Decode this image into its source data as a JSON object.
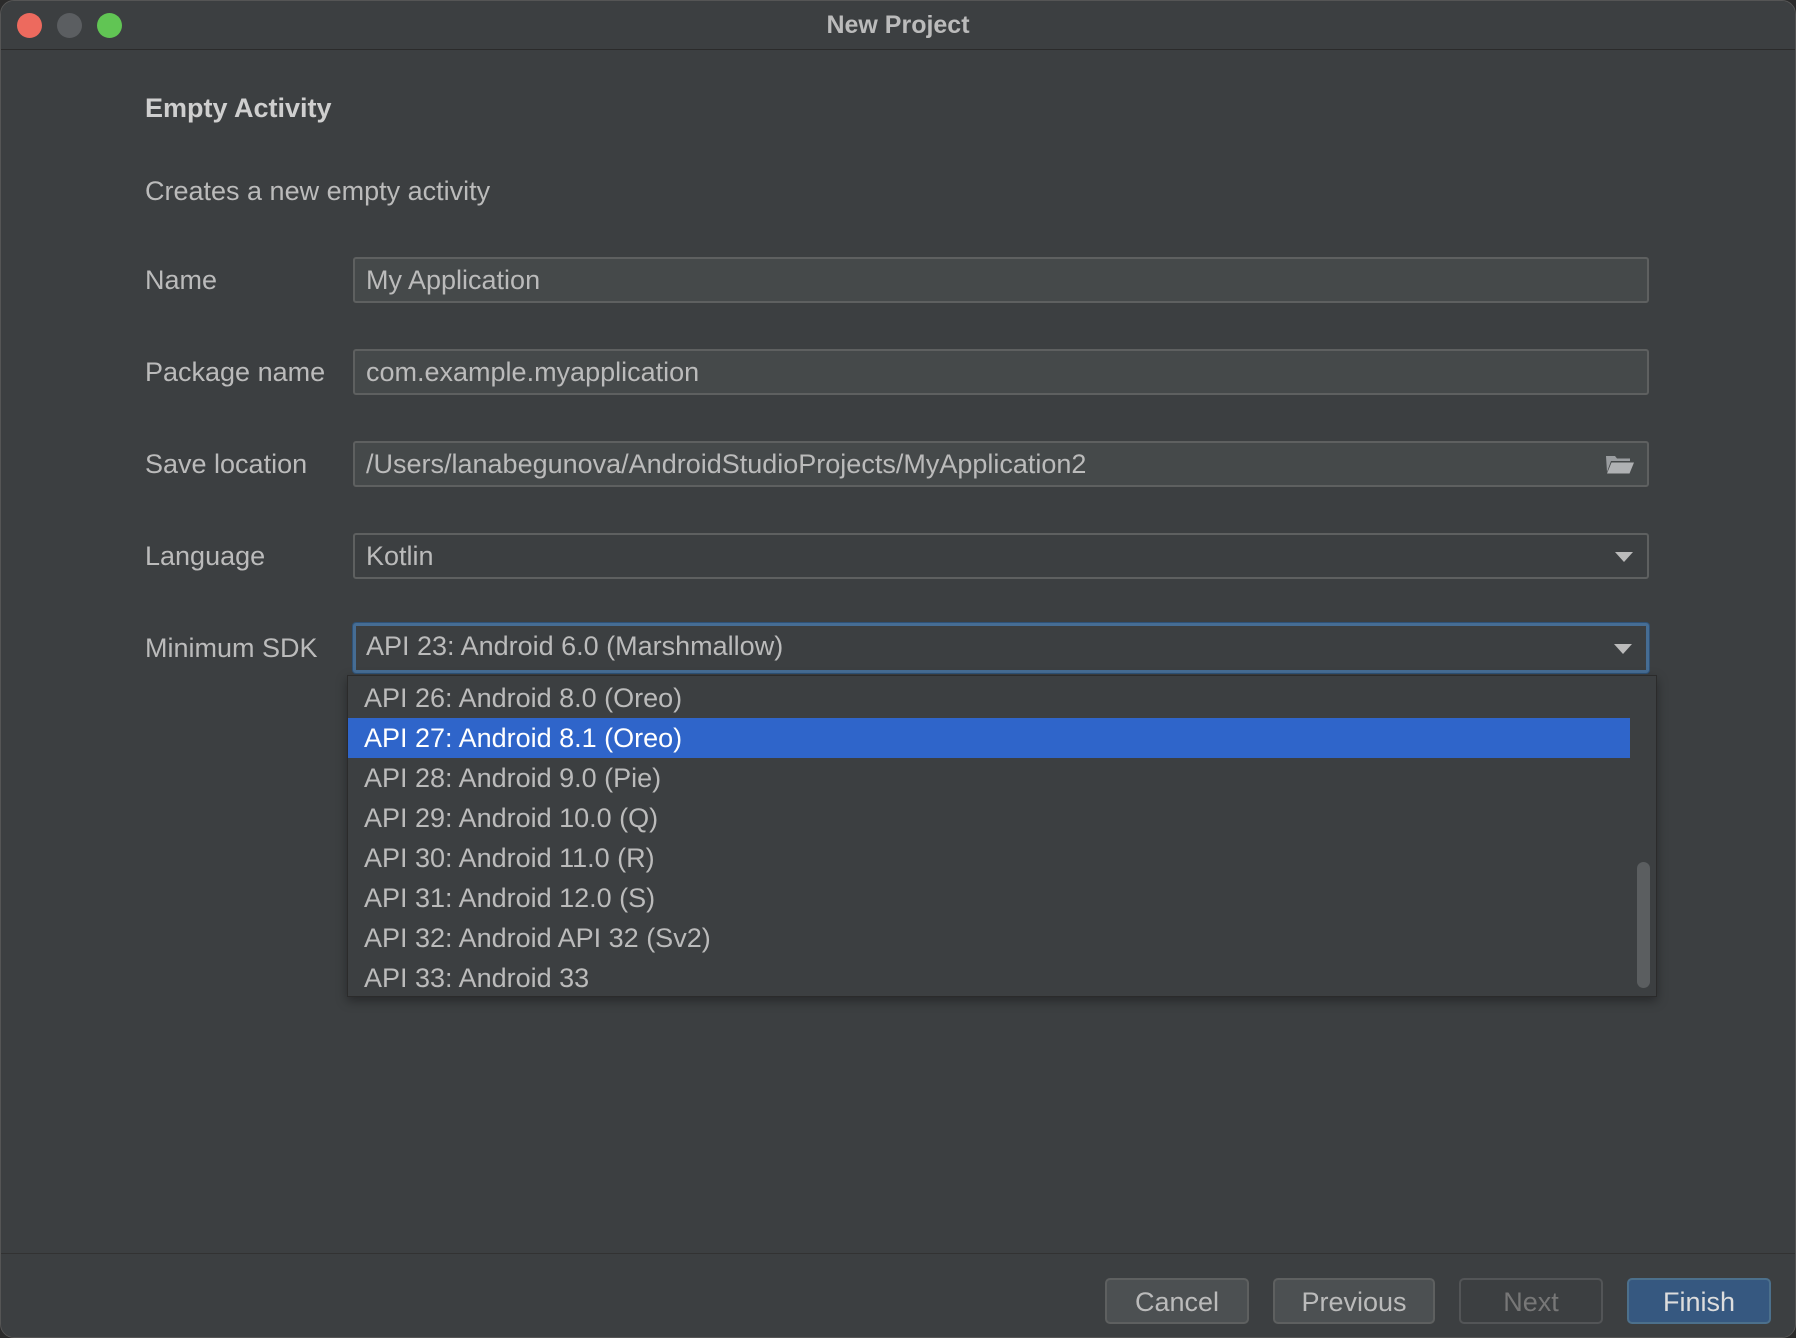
{
  "window": {
    "title": "New Project"
  },
  "page": {
    "heading": "Empty Activity",
    "description": "Creates a new empty activity"
  },
  "form": {
    "name": {
      "label": "Name",
      "value": "My Application"
    },
    "package": {
      "label": "Package name",
      "value": "com.example.myapplication"
    },
    "save_location": {
      "label": "Save location",
      "value": "/Users/lanabegunova/AndroidStudioProjects/MyApplication2",
      "icon": "folder-icon"
    },
    "language": {
      "label": "Language",
      "value": "Kotlin"
    },
    "min_sdk": {
      "label": "Minimum SDK",
      "value": "API 23: Android 6.0 (Marshmallow)"
    }
  },
  "sdk_dropdown": {
    "selected_index": 1,
    "items": [
      "API 26: Android 8.0 (Oreo)",
      "API 27: Android 8.1 (Oreo)",
      "API 28: Android 9.0 (Pie)",
      "API 29: Android 10.0 (Q)",
      "API 30: Android 11.0 (R)",
      "API 31: Android 12.0 (S)",
      "API 32: Android API 32 (Sv2)",
      "API 33: Android 33"
    ]
  },
  "buttons": {
    "cancel": "Cancel",
    "previous": "Previous",
    "next": "Next",
    "finish": "Finish"
  },
  "colors": {
    "background": "#3c3f41",
    "selection": "#2f65ca",
    "focus_border": "#466d94",
    "primary_button": "#365880"
  }
}
